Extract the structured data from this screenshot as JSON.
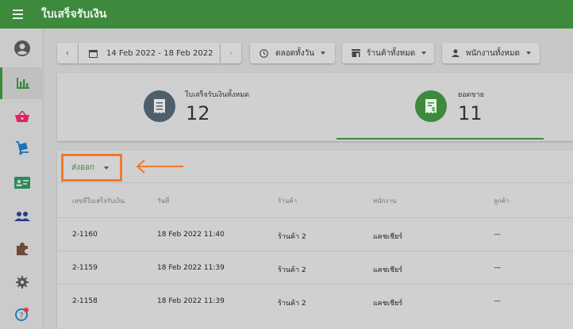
{
  "app": {
    "title": "ใบเสร็จรับเงิน"
  },
  "colors": {
    "primary": "#3d8a3d",
    "highlight": "#f07a2a",
    "receipt_icon_bg": "#4e5f6a",
    "sales_icon_bg": "#3d8a3d"
  },
  "sidebar": {
    "items": [
      {
        "icon": "account-circle-icon",
        "active": false
      },
      {
        "icon": "bar-chart-icon",
        "active": true
      },
      {
        "icon": "basket-icon",
        "active": false
      },
      {
        "icon": "dolly-icon",
        "active": false
      },
      {
        "icon": "id-card-icon",
        "active": false
      },
      {
        "icon": "people-icon",
        "active": false
      },
      {
        "icon": "puzzle-icon",
        "active": false
      },
      {
        "icon": "gear-icon",
        "active": false
      },
      {
        "icon": "help-icon",
        "active": false
      }
    ]
  },
  "filters": {
    "date_range": "14 Feb 2022 - 18 Feb 2022",
    "time": "ตลอดทั้งวัน",
    "store": "ร้านค้าทั้งหมด",
    "employee": "พนักงานทั้งหมด"
  },
  "summary": {
    "receipts": {
      "label": "ใบเสร็จรับเงินทั้งหมด",
      "value": "12"
    },
    "sales": {
      "label": "ยอดขาย",
      "value": "11"
    }
  },
  "table": {
    "export_label": "ส่งออก",
    "headers": [
      "เลขที่ใบเสร็จรับเงิน.",
      "วันที่",
      "ร้านค้า",
      "พนักงาน",
      "ลูกค้า"
    ],
    "rows": [
      [
        "2-1160",
        "18 Feb 2022 11:40",
        "ร้านค้า 2",
        "แคชเชียร์",
        "—"
      ],
      [
        "2-1159",
        "18 Feb 2022 11:39",
        "ร้านค้า 2",
        "แคชเชียร์",
        "—"
      ],
      [
        "2-1158",
        "18 Feb 2022 11:39",
        "ร้านค้า 2",
        "แคชเชียร์",
        "—"
      ]
    ]
  }
}
